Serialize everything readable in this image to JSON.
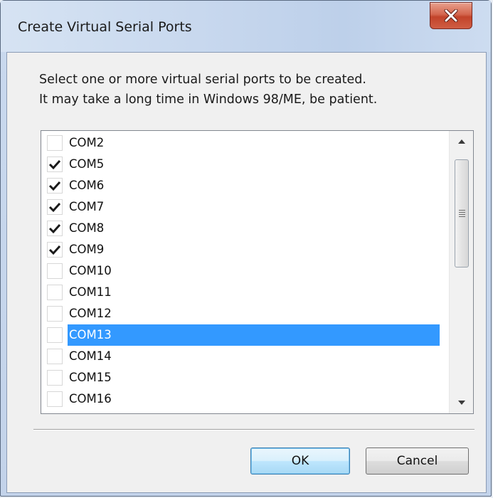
{
  "window": {
    "title": "Create Virtual Serial Ports"
  },
  "description": {
    "line1": "Select one or more virtual serial ports to be created.",
    "line2": "It may take a long time in Windows 98/ME, be patient."
  },
  "ports": [
    {
      "name": "COM2",
      "checked": false,
      "selected": false
    },
    {
      "name": "COM5",
      "checked": true,
      "selected": false
    },
    {
      "name": "COM6",
      "checked": true,
      "selected": false
    },
    {
      "name": "COM7",
      "checked": true,
      "selected": false
    },
    {
      "name": "COM8",
      "checked": true,
      "selected": false
    },
    {
      "name": "COM9",
      "checked": true,
      "selected": false
    },
    {
      "name": "COM10",
      "checked": false,
      "selected": false
    },
    {
      "name": "COM11",
      "checked": false,
      "selected": false
    },
    {
      "name": "COM12",
      "checked": false,
      "selected": false
    },
    {
      "name": "COM13",
      "checked": false,
      "selected": true
    },
    {
      "name": "COM14",
      "checked": false,
      "selected": false
    },
    {
      "name": "COM15",
      "checked": false,
      "selected": false
    },
    {
      "name": "COM16",
      "checked": false,
      "selected": false
    }
  ],
  "buttons": {
    "ok": "OK",
    "cancel": "Cancel"
  },
  "colors": {
    "selection": "#3399ff",
    "close": "#c2432a"
  },
  "icons": {
    "close": "close-icon",
    "check": "checkmark-icon",
    "scroll_up": "scroll-up-arrow-icon",
    "scroll_down": "scroll-down-arrow-icon"
  }
}
